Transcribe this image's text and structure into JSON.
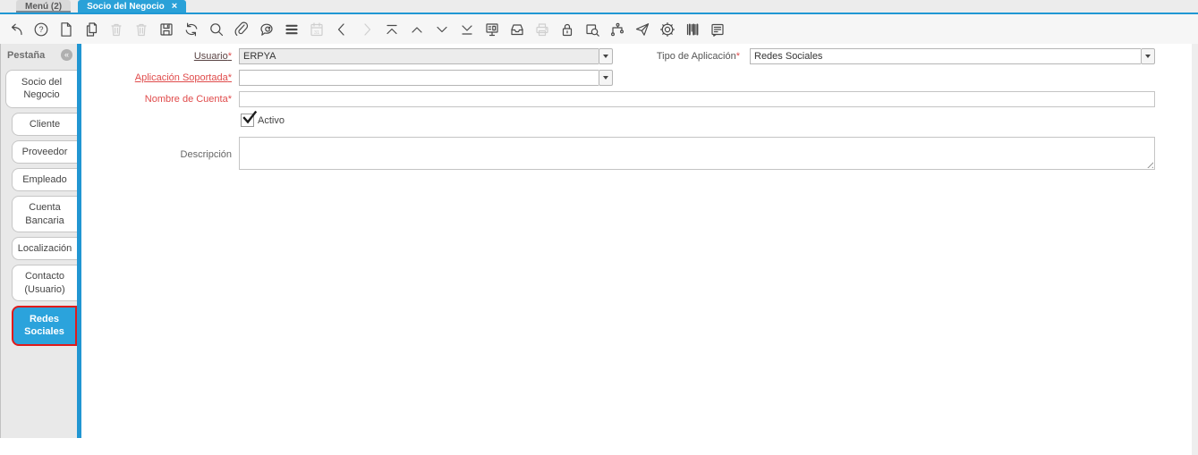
{
  "window_tabs": {
    "items": [
      {
        "label": "Menú (2)",
        "active": false
      },
      {
        "label": "Socio del Negocio",
        "active": true,
        "close_glyph": "×"
      }
    ]
  },
  "toolbar": {
    "buttons": [
      {
        "name": "undo",
        "enabled": true
      },
      {
        "name": "help",
        "enabled": true
      },
      {
        "name": "new-record",
        "enabled": true
      },
      {
        "name": "copy-record",
        "enabled": true
      },
      {
        "name": "delete-record",
        "enabled": false
      },
      {
        "name": "delete-selection",
        "enabled": false
      },
      {
        "name": "save",
        "enabled": true
      },
      {
        "name": "refresh",
        "enabled": true
      },
      {
        "name": "find",
        "enabled": true
      },
      {
        "name": "attachment",
        "enabled": true
      },
      {
        "name": "chat",
        "enabled": true
      },
      {
        "name": "toggle-view",
        "enabled": true
      },
      {
        "name": "calendar",
        "enabled": false,
        "glyph_text": "31"
      },
      {
        "name": "parent-record",
        "enabled": true
      },
      {
        "name": "detail-record",
        "enabled": false
      },
      {
        "name": "first-record",
        "enabled": true
      },
      {
        "name": "previous-record",
        "enabled": true
      },
      {
        "name": "next-record",
        "enabled": true
      },
      {
        "name": "last-record",
        "enabled": true
      },
      {
        "name": "report",
        "enabled": true
      },
      {
        "name": "archive",
        "enabled": true
      },
      {
        "name": "print",
        "enabled": false
      },
      {
        "name": "lock",
        "enabled": true
      },
      {
        "name": "zoom-across",
        "enabled": true
      },
      {
        "name": "workflow",
        "enabled": true
      },
      {
        "name": "send-mail",
        "enabled": true
      },
      {
        "name": "preferences",
        "enabled": true
      },
      {
        "name": "barcode",
        "enabled": true
      },
      {
        "name": "comments",
        "enabled": true
      }
    ]
  },
  "sidebar": {
    "header_label": "Pestaña",
    "collapse_glyph": "«",
    "tabs": [
      {
        "label": "Socio del Negocio",
        "level": 0,
        "active": false
      },
      {
        "label": "Cliente",
        "level": 1,
        "active": false
      },
      {
        "label": "Proveedor",
        "level": 1,
        "active": false
      },
      {
        "label": "Empleado",
        "level": 1,
        "active": false
      },
      {
        "label": "Cuenta Bancaria",
        "level": 1,
        "active": false
      },
      {
        "label": "Localización",
        "level": 1,
        "active": false
      },
      {
        "label": "Contacto (Usuario)",
        "level": 1,
        "active": false
      },
      {
        "label": "Redes Sociales",
        "level": 1,
        "active": true,
        "highlighted": true
      }
    ]
  },
  "form": {
    "required_mark": "*",
    "usuario": {
      "label": "Usuario",
      "value": "ERPYA"
    },
    "tipo_aplicacion": {
      "label": "Tipo de Aplicación",
      "value": "Redes Sociales"
    },
    "aplicacion_soportada": {
      "label": "Aplicación Soportada",
      "value": ""
    },
    "nombre_cuenta": {
      "label": "Nombre de Cuenta",
      "value": ""
    },
    "activo": {
      "label": "Activo",
      "checked": true
    },
    "descripcion": {
      "label": "Descripción",
      "value": ""
    }
  },
  "colors": {
    "accent_blue": "#2aa1d8",
    "strip_blue": "#2196d2",
    "mandatory_red": "#e04b4b",
    "highlight_red": "#e01b1b"
  }
}
